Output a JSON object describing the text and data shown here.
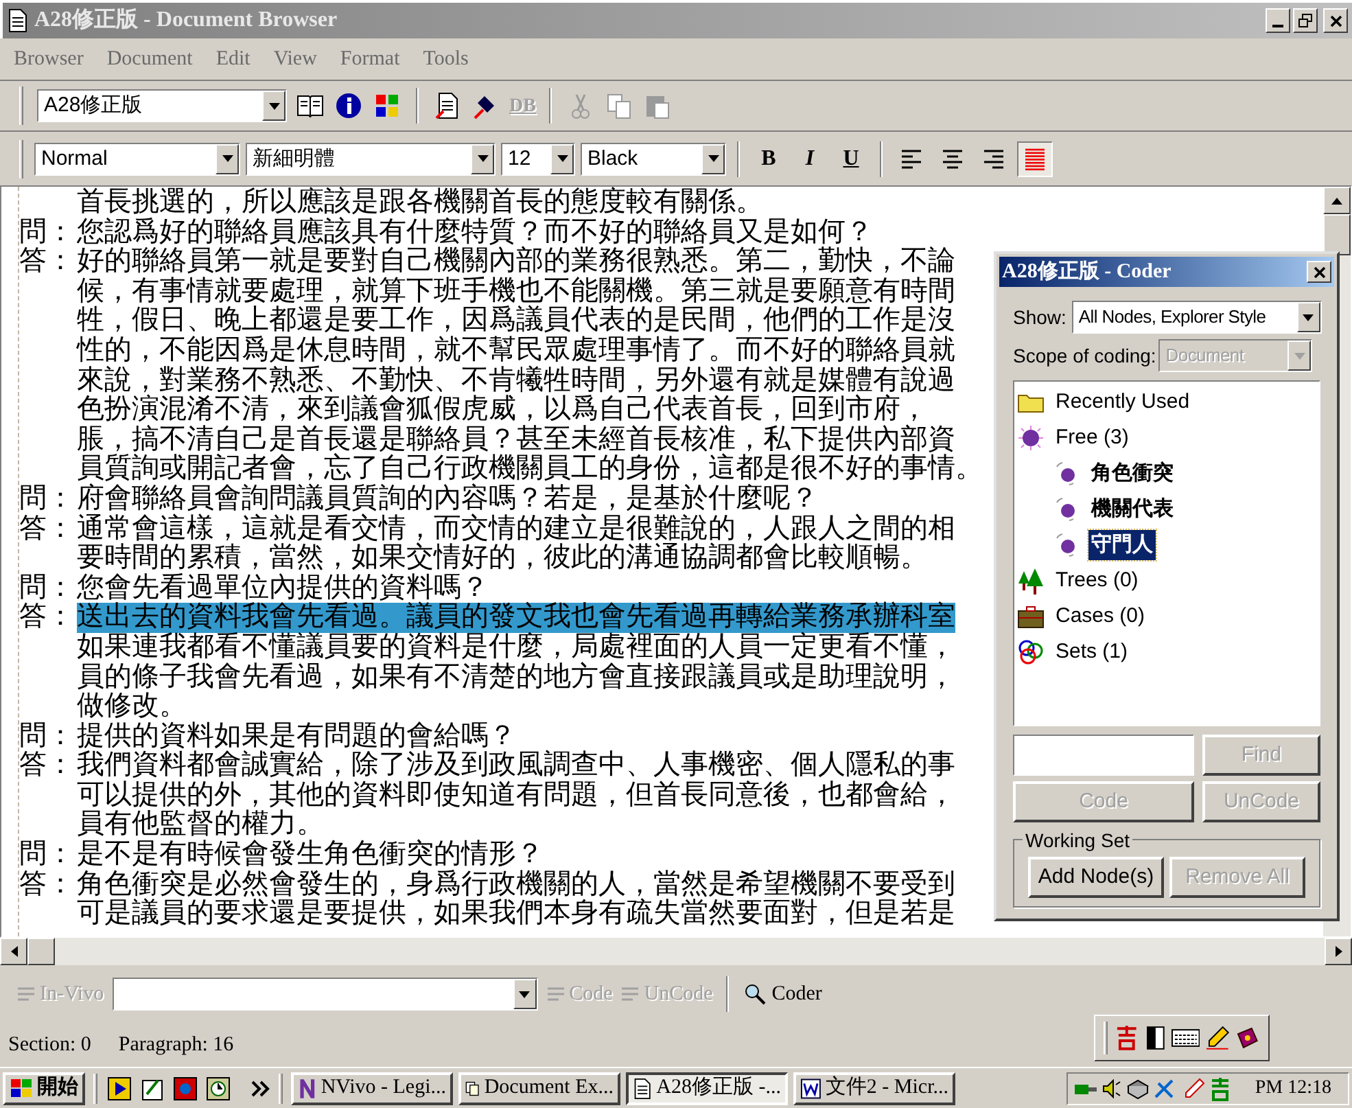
{
  "window": {
    "title": "A28修正版 - Document Browser"
  },
  "menu": [
    "Browser",
    "Document",
    "Edit",
    "View",
    "Format",
    "Tools"
  ],
  "toolbar": {
    "document": "A28修正版",
    "buttons": [
      {
        "kind": "book",
        "disabled": false
      },
      {
        "kind": "info",
        "disabled": false
      },
      {
        "kind": "grid",
        "disabled": false
      },
      {
        "kind": "sep"
      },
      {
        "kind": "page",
        "disabled": false
      },
      {
        "kind": "pen",
        "disabled": false
      },
      {
        "kind": "db",
        "label": "DB",
        "disabled": true
      },
      {
        "kind": "sep"
      },
      {
        "kind": "cut",
        "disabled": true
      },
      {
        "kind": "copy",
        "disabled": true
      },
      {
        "kind": "paste",
        "disabled": true
      }
    ]
  },
  "format_bar": {
    "combos": [
      "Normal",
      "新細明體",
      "12",
      "Black"
    ],
    "buttons": [
      {
        "kind": "bold",
        "label": "B",
        "pressed": false
      },
      {
        "kind": "italic",
        "label": "I",
        "pressed": false
      },
      {
        "kind": "underline",
        "label": "U",
        "pressed": false
      },
      {
        "kind": "sep"
      },
      {
        "kind": "align-left",
        "pressed": false
      },
      {
        "kind": "align-center",
        "pressed": false
      },
      {
        "kind": "align-right",
        "pressed": false
      },
      {
        "kind": "color",
        "pressed": true
      }
    ]
  },
  "document": {
    "lines": [
      {
        "text": "首長挑選的，所以應該是跟各機關首長的態度較有關係。",
        "highlighted": false
      },
      {
        "label": "問：",
        "text": "您認爲好的聯絡員應該具有什麼特質？而不好的聯絡員又是如何？",
        "highlighted": false
      },
      {
        "label": "答：",
        "text": "好的聯絡員第一就是要對自己機關內部的業務很熟悉。第二，勤快，不論",
        "highlighted": false
      },
      {
        "text": "候，有事情就要處理，就算下班手機也不能關機。第三就是要願意有時間",
        "highlighted": false
      },
      {
        "text": "牲，假日、晚上都還是要工作，因爲議員代表的是民間，他們的工作是沒",
        "highlighted": false
      },
      {
        "text": "性的，不能因爲是休息時間，就不幫民眾處理事情了。而不好的聯絡員就",
        "highlighted": false
      },
      {
        "text": "來說，對業務不熟悉、不勤快、不肯犧牲時間，另外還有就是媒體有說過",
        "highlighted": false
      },
      {
        "text": "色扮演混淆不清，來到議會狐假虎威，以爲自己代表首長，回到市府，",
        "highlighted": false
      },
      {
        "text": "脹，搞不清自己是首長還是聯絡員？甚至未經首長核准，私下提供內部資",
        "highlighted": false
      },
      {
        "text": "員質詢或開記者會，忘了自己行政機關員工的身份，這都是很不好的事情。",
        "highlighted": false
      },
      {
        "label": "問：",
        "text": "府會聯絡員會詢問議員質詢的內容嗎？若是，是基於什麼呢？",
        "highlighted": false
      },
      {
        "label": "答：",
        "text": "通常會這樣，這就是看交情，而交情的建立是很難說的，人跟人之間的相",
        "highlighted": false
      },
      {
        "text": "要時間的累積，當然，如果交情好的，彼此的溝通協調都會比較順暢。",
        "highlighted": false
      },
      {
        "label": "問：",
        "text": "您會先看過單位內提供的資料嗎？",
        "highlighted": false
      },
      {
        "label": "答：",
        "text": "送出去的資料我會先看過。議員的發文我也會先看過再轉給業務承辦科室",
        "highlighted": true
      },
      {
        "text": "如果連我都看不懂議員要的資料是什麼，局處裡面的人員一定更看不懂，",
        "highlighted": false
      },
      {
        "text": "員的條子我會先看過，如果有不清楚的地方會直接跟議員或是助理說明，",
        "highlighted": false
      },
      {
        "text": "做修改。",
        "highlighted": false
      },
      {
        "label": "問：",
        "text": "提供的資料如果是有問題的會給嗎？",
        "highlighted": false
      },
      {
        "label": "答：",
        "text": "我們資料都會誠實給，除了涉及到政風調查中、人事機密、個人隱私的事",
        "highlighted": false
      },
      {
        "text": "可以提供的外，其他的資料即使知道有問題，但首長同意後，也都會給，",
        "highlighted": false
      },
      {
        "text": "員有他監督的權力。",
        "highlighted": false
      },
      {
        "label": "問：",
        "text": "是不是有時候會發生角色衝突的情形？",
        "highlighted": false
      },
      {
        "label": "答：",
        "text": "角色衝突是必然會發生的，身爲行政機關的人，當然是希望機關不要受到",
        "highlighted": false
      },
      {
        "text": "可是議員的要求還是要提供，如果我們本身有疏失當然要面對，但是若是",
        "highlighted": false
      }
    ]
  },
  "coder": {
    "title": "A28修正版 - Coder",
    "show_label": "Show:",
    "show_value": "All Nodes, Explorer Style",
    "scope_label": "Scope of coding:",
    "scope_value": "Document",
    "scope_disabled": true,
    "tree": [
      {
        "kind": "folder",
        "label": "Recently Used",
        "selected": false
      },
      {
        "kind": "free",
        "label": "Free (3)",
        "selected": false,
        "children": [
          {
            "kind": "node",
            "label": "角色衝突",
            "selected": false
          },
          {
            "kind": "node",
            "label": "機關代表",
            "selected": false
          },
          {
            "kind": "node",
            "label": "守門人",
            "selected": true
          }
        ]
      },
      {
        "kind": "trees",
        "label": "Trees (0)",
        "selected": false
      },
      {
        "kind": "cases",
        "label": "Cases (0)",
        "selected": false
      },
      {
        "kind": "sets",
        "label": "Sets (1)",
        "selected": false
      }
    ],
    "find": {
      "label": "Find",
      "disabled": true
    },
    "buttons": [
      {
        "label": "Code",
        "disabled": true
      },
      {
        "label": "UnCode",
        "disabled": true
      }
    ],
    "working_set": {
      "title": "Working Set",
      "buttons": [
        {
          "label": "Add Node(s)",
          "disabled": false
        },
        {
          "label": "Remove All",
          "disabled": true
        }
      ]
    }
  },
  "coding_bar": {
    "buttons": [
      {
        "kind": "invivo",
        "label": "In-Vivo",
        "disabled": true
      },
      {
        "kind": "combo"
      },
      {
        "kind": "code",
        "label": "Code",
        "disabled": true
      },
      {
        "kind": "code",
        "label": "UnCode",
        "disabled": true
      },
      {
        "kind": "sep"
      },
      {
        "kind": "coder",
        "label": "Coder",
        "disabled": false
      }
    ]
  },
  "status_bar": [
    "Section: 0",
    "Paragraph: 16"
  ],
  "taskbar": {
    "start": "開始",
    "tasks": [
      {
        "label": "NVivo - Legi...",
        "kind": "nvivo",
        "selected": false
      },
      {
        "label": "Document Ex...",
        "kind": "docs",
        "selected": false
      },
      {
        "label": "A28修正版 -...",
        "kind": "page",
        "selected": true
      },
      {
        "label": "文件2 - Micr...",
        "kind": "word",
        "selected": false
      }
    ],
    "clock": "PM 12:18"
  }
}
